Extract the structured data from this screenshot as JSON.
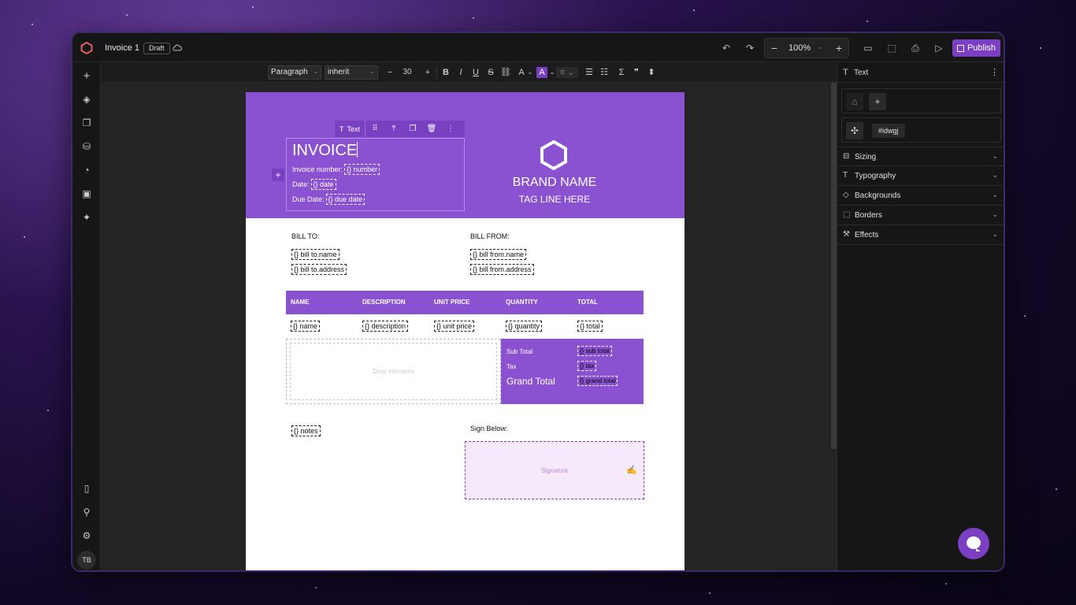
{
  "topbar": {
    "doc_title": "Invoice 1",
    "status_badge": "Draft",
    "zoom": "100%",
    "publish_label": "Publish"
  },
  "formatbar": {
    "block_type": "Paragraph",
    "font_family": "inherit",
    "font_size": "30"
  },
  "document": {
    "invoice_title": "INVOICE",
    "invoice_number_label": "Invoice number:",
    "invoice_number_ph": "{} number",
    "date_label": "Date:",
    "date_ph": "{} date",
    "due_date_label": "Due Date:",
    "due_date_ph": "{} due date",
    "element_toolbar_label": "Text",
    "brand_name": "BRAND NAME",
    "tagline": "TAG LINE HERE",
    "bill_to_label": "BILL TO:",
    "bill_to_name": "{} bill to.name",
    "bill_to_address": "{} bill to.address",
    "bill_from_label": "BILL FROM:",
    "bill_from_name": "{} bill from.name",
    "bill_from_address": "{} bill from.address",
    "table_headers": [
      "NAME",
      "DESCRIPTION",
      "UNIT PRICE",
      "QUANTITY",
      "TOTAL"
    ],
    "table_row": [
      "{} name",
      "{} description",
      "{} unit price",
      "{} quantity",
      "{} total"
    ],
    "drop_zone": "Drop elements",
    "sub_total_label": "Sub Total",
    "sub_total_ph": "{} sub total",
    "tax_label": "Tax",
    "tax_ph": "{} tax",
    "grand_total_label": "Grand Total",
    "grand_total_ph": "{} grand total",
    "notes_ph": "{} notes",
    "sign_label": "Sign Below:",
    "signature_label": "Signature"
  },
  "rightpanel": {
    "title": "Text",
    "element_id": "#idwgj",
    "sections": [
      "Sizing",
      "Typography",
      "Backgrounds",
      "Borders",
      "Effects"
    ]
  },
  "user": {
    "initials": "TB"
  },
  "colors": {
    "accent": "#8a52d1",
    "publish": "#7b3fc4",
    "app_bg": "#161616"
  },
  "icons": {
    "leftbar": [
      "plus-icon",
      "layers-icon",
      "pages-icon",
      "database-icon",
      "palette-icon",
      "image-icon",
      "ai-sparkle-icon",
      "book-icon",
      "plugin-icon",
      "settings-icon"
    ],
    "topbar": [
      "undo-icon",
      "redo-icon",
      "desktop-icon",
      "frame-icon",
      "print-icon",
      "play-icon"
    ]
  }
}
